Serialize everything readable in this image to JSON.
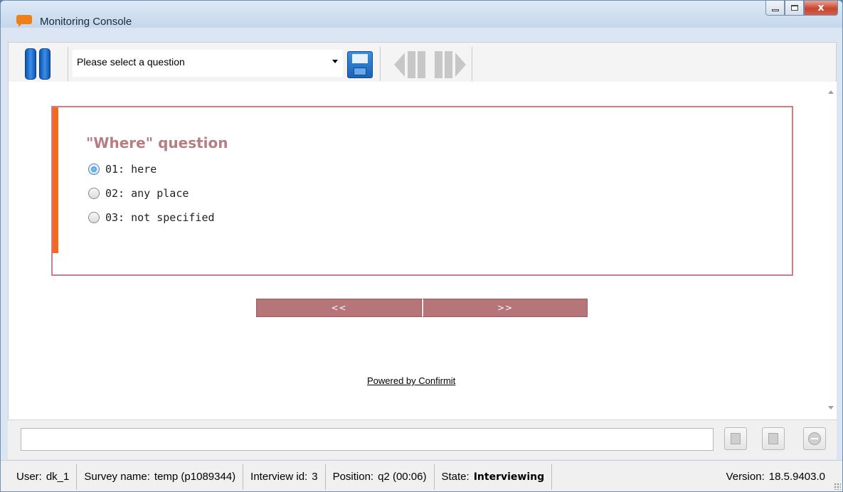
{
  "window": {
    "title": "Monitoring Console",
    "controls": {
      "minimize_icon": "minimize-icon",
      "maximize_icon": "maximize-icon",
      "close_label": "x"
    }
  },
  "toolbar": {
    "pause_icon": "pause-icon",
    "question_select": {
      "value": "Please select a question"
    },
    "save_icon": "save-icon",
    "prev_icon": "previous-icon",
    "next_icon": "next-icon"
  },
  "question": {
    "title": "\"Where\" question",
    "options": [
      {
        "label": "01: here",
        "selected": true
      },
      {
        "label": "02: any place",
        "selected": false
      },
      {
        "label": "03: not specified",
        "selected": false
      }
    ]
  },
  "navigation": {
    "back_label": "<<",
    "forward_label": ">>"
  },
  "footer": {
    "powered_by": "Powered by Confirmit"
  },
  "command": {
    "value": ""
  },
  "actions": [
    "send-icon",
    "approve-icon",
    "stop-icon"
  ],
  "status": {
    "user_label": "User:",
    "user_value": "dk_1",
    "survey_label": "Survey name:",
    "survey_value": "temp (p1089344)",
    "interview_label": "Interview id:",
    "interview_value": "3",
    "position_label": "Position:",
    "position_value": "q2 (00:06)",
    "state_label": "State:",
    "state_value": "Interviewing",
    "version_label": "Version:",
    "version_value": "18.5.9403.0"
  },
  "colors": {
    "accent_orange": "#f26a1b",
    "question_border": "#d57b86",
    "question_title": "#b67d84",
    "nav_button": "#b57579",
    "pause_blue": "#1c63b8"
  }
}
